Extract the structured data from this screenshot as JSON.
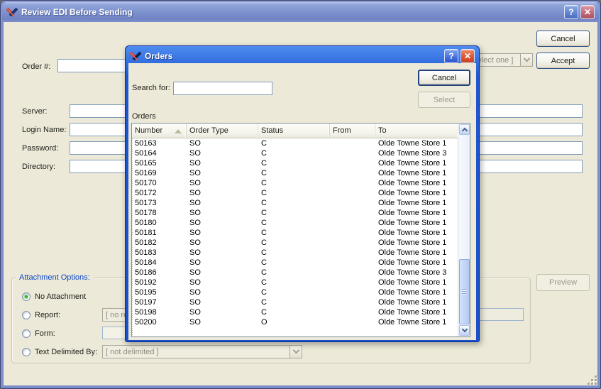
{
  "main_window": {
    "title": "Review EDI Before Sending",
    "help_glyph": "?",
    "close_glyph": "✕",
    "order_label": "Order #:",
    "order_value": "",
    "select_one_combo": "[ select one ]",
    "cancel_button": "Cancel",
    "accept_button": "Accept",
    "fields": {
      "server_label": "Server:",
      "server_value": "",
      "login_label": "Login Name:",
      "login_value": "",
      "password_label": "Password:",
      "password_value": "",
      "directory_label": "Directory:",
      "directory_value": ""
    },
    "attachment": {
      "caption": "Attachment Options:",
      "options": [
        {
          "label": "No Attachment",
          "selected": true
        },
        {
          "label": "Report:",
          "selected": false
        },
        {
          "label": "Form:",
          "selected": false
        },
        {
          "label": "Text Delimited By:",
          "selected": false
        }
      ],
      "report_combo": "[ no report ]",
      "report_field_value": "",
      "form_field_value": "",
      "delimiter_combo": "[ not delimited ]"
    },
    "preview_button": "Preview"
  },
  "orders_dialog": {
    "title": "Orders",
    "help_glyph": "?",
    "close_glyph": "✕",
    "search_label": "Search for:",
    "search_value": "",
    "cancel_button": "Cancel",
    "select_button": "Select",
    "list_label": "Orders",
    "table": {
      "headers": [
        "Number",
        "Order Type",
        "Status",
        "From",
        "To"
      ],
      "sort_column": "Number",
      "sort_direction": "ascending",
      "rows": [
        {
          "number": "50163",
          "order_type": "SO",
          "status": "C",
          "from": "",
          "to": "Olde Towne Store 1"
        },
        {
          "number": "50164",
          "order_type": "SO",
          "status": "C",
          "from": "",
          "to": "Olde Towne Store 3"
        },
        {
          "number": "50165",
          "order_type": "SO",
          "status": "C",
          "from": "",
          "to": "Olde Towne Store 1"
        },
        {
          "number": "50169",
          "order_type": "SO",
          "status": "C",
          "from": "",
          "to": "Olde Towne Store 1"
        },
        {
          "number": "50170",
          "order_type": "SO",
          "status": "C",
          "from": "",
          "to": "Olde Towne Store 1"
        },
        {
          "number": "50172",
          "order_type": "SO",
          "status": "C",
          "from": "",
          "to": "Olde Towne Store 1"
        },
        {
          "number": "50173",
          "order_type": "SO",
          "status": "C",
          "from": "",
          "to": "Olde Towne Store 1"
        },
        {
          "number": "50178",
          "order_type": "SO",
          "status": "C",
          "from": "",
          "to": "Olde Towne Store 1"
        },
        {
          "number": "50180",
          "order_type": "SO",
          "status": "C",
          "from": "",
          "to": "Olde Towne Store 1"
        },
        {
          "number": "50181",
          "order_type": "SO",
          "status": "C",
          "from": "",
          "to": "Olde Towne Store 1"
        },
        {
          "number": "50182",
          "order_type": "SO",
          "status": "C",
          "from": "",
          "to": "Olde Towne Store 1"
        },
        {
          "number": "50183",
          "order_type": "SO",
          "status": "C",
          "from": "",
          "to": "Olde Towne Store 1"
        },
        {
          "number": "50184",
          "order_type": "SO",
          "status": "C",
          "from": "",
          "to": "Olde Towne Store 1"
        },
        {
          "number": "50186",
          "order_type": "SO",
          "status": "C",
          "from": "",
          "to": "Olde Towne Store 3"
        },
        {
          "number": "50192",
          "order_type": "SO",
          "status": "C",
          "from": "",
          "to": "Olde Towne Store 1"
        },
        {
          "number": "50195",
          "order_type": "SO",
          "status": "C",
          "from": "",
          "to": "Olde Towne Store 1"
        },
        {
          "number": "50197",
          "order_type": "SO",
          "status": "C",
          "from": "",
          "to": "Olde Towne Store 1"
        },
        {
          "number": "50198",
          "order_type": "SO",
          "status": "C",
          "from": "",
          "to": "Olde Towne Store 1"
        },
        {
          "number": "50200",
          "order_type": "SO",
          "status": "O",
          "from": "",
          "to": "Olde Towne Store 1"
        }
      ]
    }
  },
  "colors": {
    "active_title_blue": "#1a50c8",
    "inactive_title_blue": "#7e92ce",
    "dialog_bg": "#ece9d8",
    "close_red": "#dd5232",
    "groupbox_caption_blue": "#0b48c4",
    "radio_selected_green": "#3fae33"
  }
}
